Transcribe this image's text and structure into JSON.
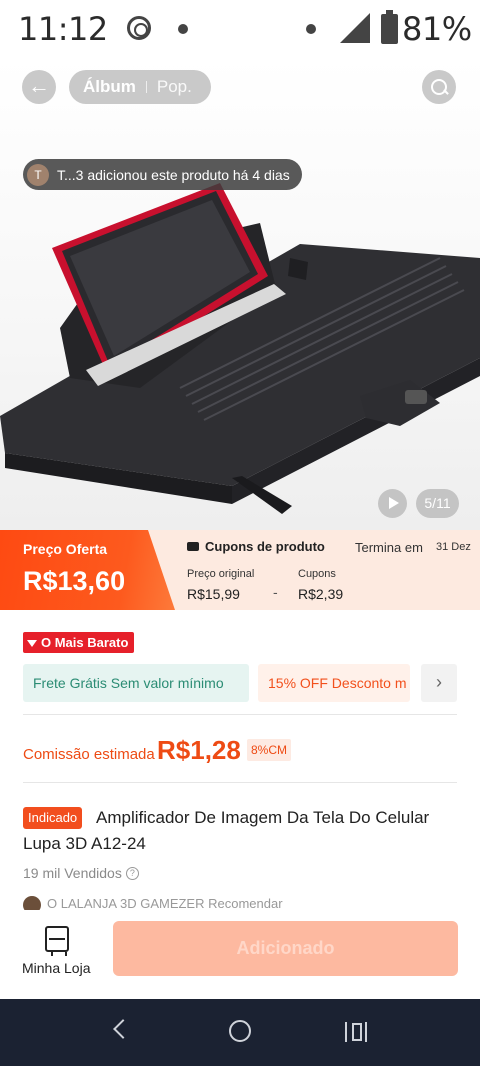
{
  "status_bar": {
    "time": "11:12",
    "battery_percent": "81%"
  },
  "header": {
    "tabs": [
      {
        "label": "Álbum",
        "active": true
      },
      {
        "label": "Pop.",
        "active": false
      }
    ],
    "back_icon": "arrow-left-icon",
    "search_icon": "search-icon"
  },
  "gallery": {
    "activity": {
      "avatar_letter": "T",
      "text": "T...3 adicionou este produto há 4 dias"
    },
    "counter": "5/11"
  },
  "price_banner": {
    "label": "Preço Oferta",
    "price": "R$13,60",
    "coupon_title": "Cupons de produto",
    "ends_label": "Termina em",
    "ends_date": "31 Dez",
    "original_label": "Preço original",
    "original_value": "R$15,99",
    "minus": "-",
    "coupons_label": "Cupons",
    "coupons_value": "R$2,39"
  },
  "badges": {
    "cheapest": "O Mais Barato"
  },
  "promos": {
    "free_shipping": "Frete Grátis Sem valor mínimo",
    "discount": "15% OFF Desconto m"
  },
  "commission": {
    "label": "Comissão estimada",
    "value": "R$1,28",
    "rate": "8%CM"
  },
  "product": {
    "tag": "Indicado",
    "title_line1": "Amplificador De Imagem Da Tela Do Celular",
    "title_line2": "Lupa 3D A12-24",
    "sold": "19 mil Vendidos",
    "recommend_text": "O LALANJA 3D GAMEZER Recomendar"
  },
  "action_bar": {
    "store_label": "Minha Loja",
    "add_label": "Adicionado"
  },
  "colors": {
    "accent": "#fe4a12",
    "promo_green": "#2b8c74",
    "nav_dark": "#1b2232"
  }
}
